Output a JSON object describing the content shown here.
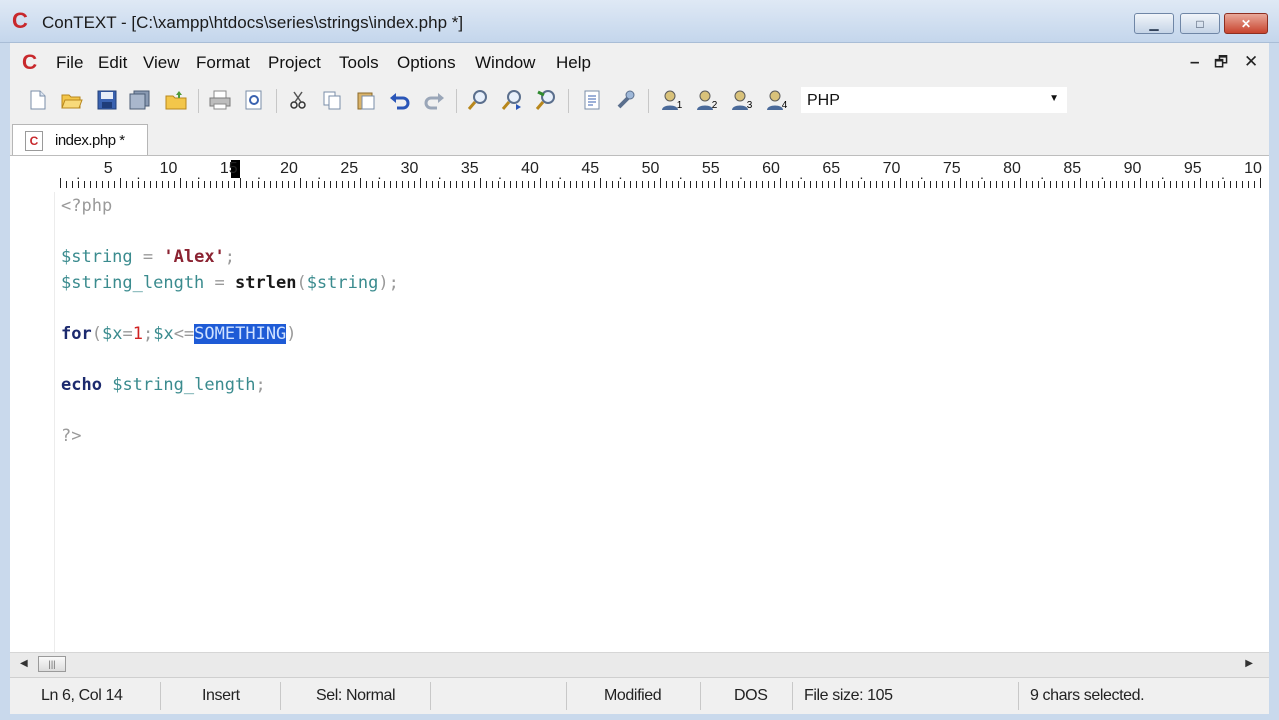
{
  "window": {
    "title": "ConTEXT - [C:\\xampp\\htdocs\\series\\strings\\index.php *]",
    "logo": "C",
    "minimize_icon": "▁",
    "maximize_icon": "□",
    "close_icon": "✕"
  },
  "menubar": {
    "logo": "C",
    "items": [
      "File",
      "Edit",
      "View",
      "Format",
      "Project",
      "Tools",
      "Options",
      "Window",
      "Help"
    ],
    "mdi_minimize": "–",
    "mdi_restore": "🗗",
    "mdi_close": "✕"
  },
  "toolbar": {
    "icons": [
      "new-file-icon",
      "open-file-icon",
      "save-icon",
      "save-all-icon",
      "open-folder-icon",
      "print-icon",
      "print-preview-icon",
      "cut-icon",
      "copy-icon",
      "paste-icon",
      "undo-icon",
      "redo-icon",
      "find-icon",
      "find-next-icon",
      "replace-icon",
      "document-properties-icon",
      "tools-icon",
      "user-tool-1-icon",
      "user-tool-2-icon",
      "user-tool-3-icon",
      "user-tool-4-icon"
    ],
    "tool_labels": [
      "1",
      "2",
      "3",
      "4"
    ],
    "language": "PHP"
  },
  "tab": {
    "icon": "C",
    "label": "index.php *"
  },
  "ruler": {
    "numbers": [
      "5",
      "10",
      "15",
      "20",
      "25",
      "30",
      "35",
      "40",
      "45",
      "50",
      "55",
      "60",
      "65",
      "70",
      "75",
      "80",
      "85",
      "90",
      "95",
      "10"
    ]
  },
  "editor": {
    "lines": [
      {
        "parts": [
          [
            "tag",
            "<?php"
          ]
        ]
      },
      {
        "parts": []
      },
      {
        "parts": [
          [
            "var",
            "$string"
          ],
          [
            "op",
            " = "
          ],
          [
            "str",
            "'Alex'"
          ],
          [
            "op",
            ";"
          ]
        ]
      },
      {
        "parts": [
          [
            "var",
            "$string_length"
          ],
          [
            "op",
            " = "
          ],
          [
            "fn",
            "strlen"
          ],
          [
            "op",
            "("
          ],
          [
            "var",
            "$string"
          ],
          [
            "op",
            ");"
          ]
        ]
      },
      {
        "parts": []
      },
      {
        "parts": [
          [
            "kw",
            "for"
          ],
          [
            "op",
            "("
          ],
          [
            "var",
            "$x"
          ],
          [
            "op",
            "="
          ],
          [
            "num",
            "1"
          ],
          [
            "op",
            ";"
          ],
          [
            "var",
            "$x"
          ],
          [
            "op",
            "<="
          ],
          [
            "sel",
            "SOMETHING"
          ],
          [
            "op",
            ")"
          ]
        ]
      },
      {
        "parts": []
      },
      {
        "parts": [
          [
            "kw",
            "echo"
          ],
          [
            "op",
            " "
          ],
          [
            "var",
            "$string_length"
          ],
          [
            "op",
            ";"
          ]
        ]
      },
      {
        "parts": []
      },
      {
        "parts": [
          [
            "tag",
            "?>"
          ]
        ]
      }
    ]
  },
  "statusbar": {
    "position": "Ln 6, Col 14",
    "mode": "Insert",
    "selection_mode": "Sel: Normal",
    "modified": "Modified",
    "line_ending": "DOS",
    "file_size": "File size: 105",
    "selected": "9 chars selected."
  },
  "colors": {
    "keyword": "#1c2a6e",
    "variable": "#3a8b8e",
    "string": "#8b2332",
    "number": "#d02222",
    "selection": "#1e5bd6"
  }
}
